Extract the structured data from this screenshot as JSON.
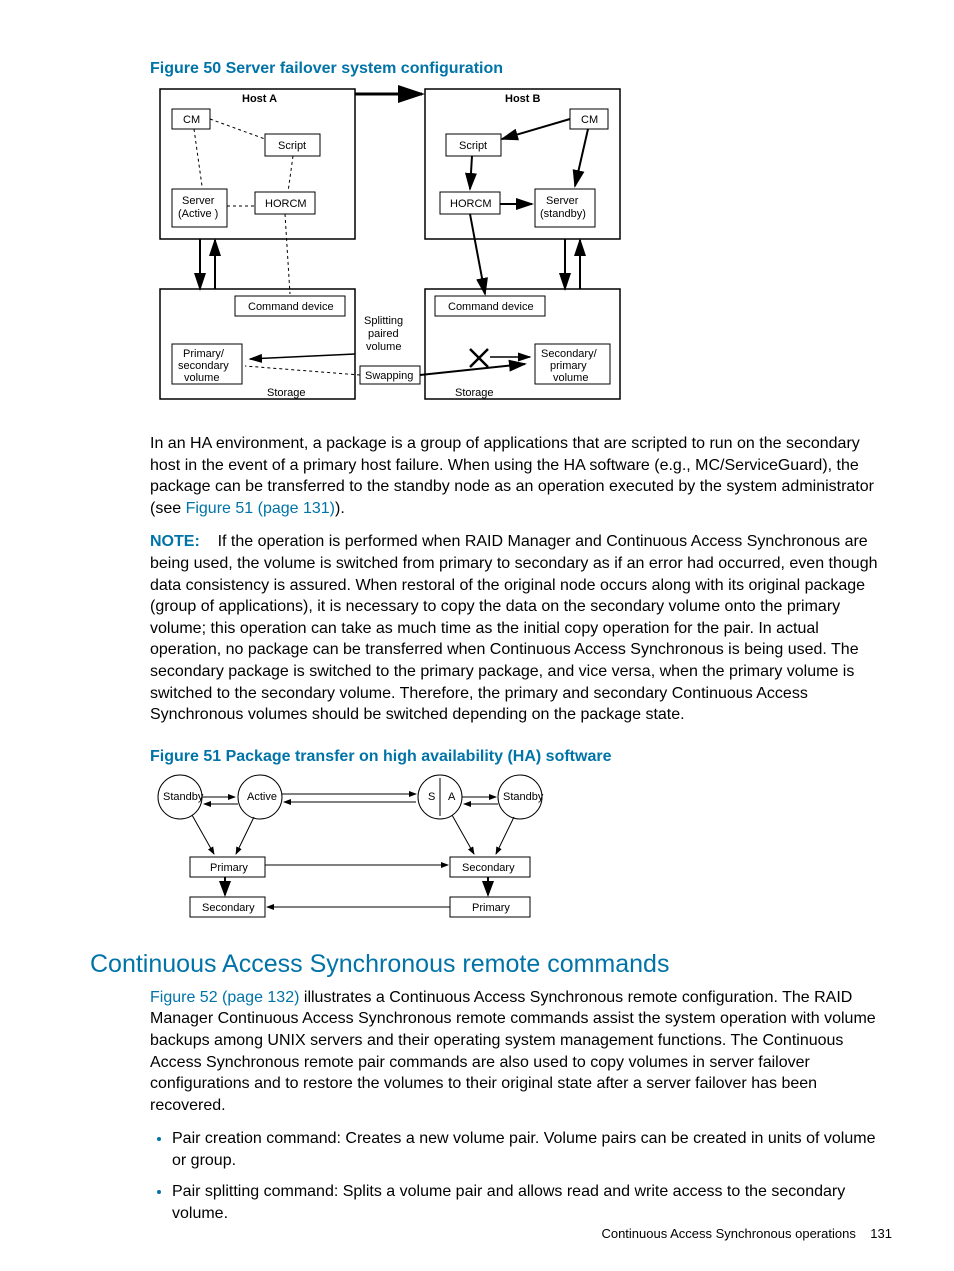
{
  "fig50": {
    "caption": "Figure 50 Server failover system configuration",
    "labels": {
      "hostA": "Host A",
      "hostB": "Host B",
      "cm": "CM",
      "script": "Script",
      "server_active_l1": "Server",
      "server_active_l2": "(Active )",
      "server_standby_l1": "Server",
      "server_standby_l2": "(standby)",
      "horcm": "HORCM",
      "cmd_dev": "Command device",
      "split_l1": "Splitting",
      "split_l2": "paired",
      "split_l3": "volume",
      "swap": "Swapping",
      "storage": "Storage",
      "pri_sec_l1": "Primary/",
      "pri_sec_l2": "secondary",
      "pri_sec_l3": "volume",
      "sec_pri_l1": "Secondary/",
      "sec_pri_l2": "primary",
      "sec_pri_l3": "volume"
    }
  },
  "para1": {
    "text_a": "In an HA environment, a package is a group of applications that are scripted to run on the secondary host in the event of a primary host failure. When using the HA software (e.g., MC/ServiceGuard), the package can be transferred to the standby node as an operation executed by the system administrator (see ",
    "link": "Figure 51 (page 131)",
    "text_b": ")."
  },
  "note": {
    "label": "NOTE:",
    "text": "If the operation is performed when RAID Manager and Continuous Access Synchronous are being used, the volume is switched from primary to secondary as if an error had occurred, even though data consistency is assured. When restoral of the original node occurs along with its original package (group of applications), it is necessary to copy the data on the secondary volume onto the primary volume; this operation can take as much time as the initial copy operation for the pair. In actual operation, no package can be transferred when Continuous Access Synchronous is being used. The secondary package is switched to the primary package, and vice versa, when the primary volume is switched to the secondary volume. Therefore, the primary and secondary Continuous Access Synchronous volumes should be switched depending on the package state."
  },
  "fig51": {
    "caption": "Figure 51 Package transfer on high availability (HA) software",
    "labels": {
      "standby": "Standby",
      "active": "Active",
      "s": "S",
      "a": "A",
      "primary": "Primary",
      "secondary": "Secondary"
    }
  },
  "section": {
    "heading": "Continuous Access Synchronous remote commands",
    "para_link": "Figure 52 (page 132)",
    "para_text": " illustrates a Continuous Access Synchronous remote configuration. The RAID Manager Continuous Access Synchronous remote commands assist the system operation with volume backups among UNIX servers and their operating system management functions. The Continuous Access Synchronous remote pair commands are also used to copy volumes in server failover configurations and to restore the volumes to their original state after a server failover has been recovered.",
    "bullet1": "Pair creation command: Creates a new volume pair. Volume pairs can be created in units of volume or group.",
    "bullet2": "Pair splitting command: Splits a volume pair and allows read and write access to the secondary volume."
  },
  "footer": {
    "text": "Continuous Access Synchronous operations",
    "page": "131"
  }
}
